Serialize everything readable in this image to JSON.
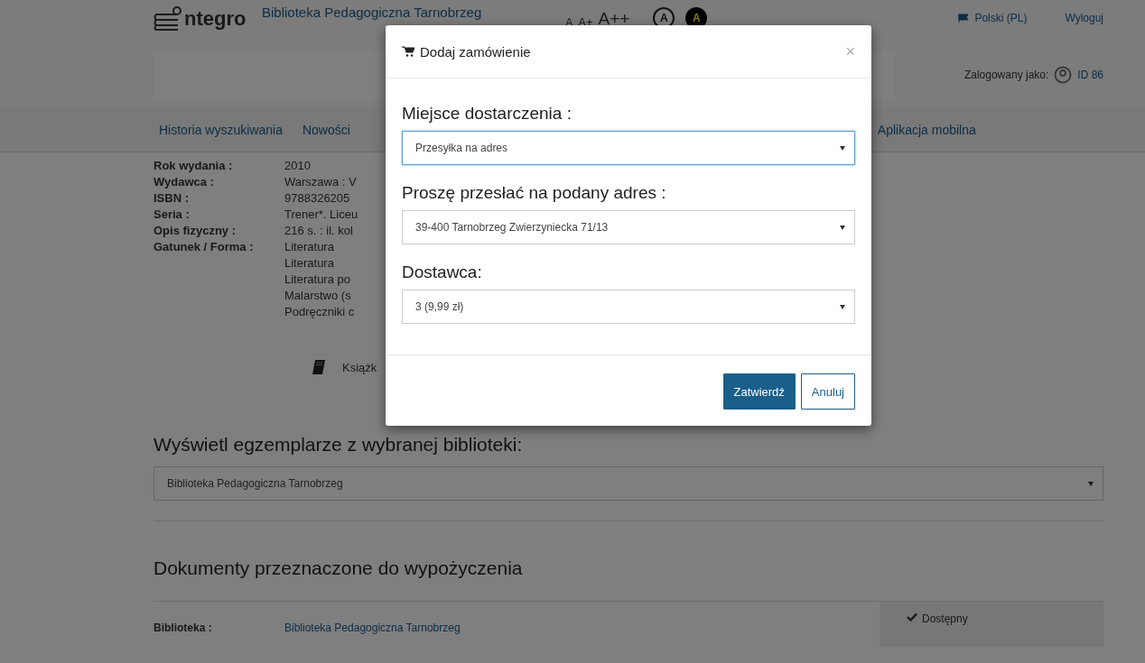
{
  "header": {
    "logo": "ntegro",
    "library_name": "Biblioteka Pedagogiczna Tarnobrzeg",
    "font_sizes": [
      "A",
      "A+",
      "A++"
    ],
    "contrast": [
      {
        "label": "A",
        "kind": "normal"
      },
      {
        "label": "A",
        "kind": "high"
      }
    ],
    "language": "Polski (PL)",
    "logout": "Wyloguj",
    "logged_in_label": "Zalogowany jako:",
    "user": "ID 86"
  },
  "nav": [
    {
      "label": "Historia wyszukiwania"
    },
    {
      "label": "Nowości"
    },
    {
      "label": "Aplikacja mobilna"
    }
  ],
  "details": [
    {
      "label": "Rok wydania :",
      "values": [
        "2010"
      ]
    },
    {
      "label": "Wydawca :",
      "values": [
        "Warszawa : V"
      ]
    },
    {
      "label": "ISBN :",
      "values": [
        "9788326205"
      ]
    },
    {
      "label": "Seria :",
      "values": [
        "Trener*. Liceu"
      ]
    },
    {
      "label": "Opis fizyczny :",
      "values": [
        "216 s. : il. kol"
      ]
    },
    {
      "label": "Gatunek / Forma :",
      "values": [
        "Literatura",
        "Literatura",
        "Literatura po",
        "Malarstwo (s",
        "Podręczniki c"
      ]
    }
  ],
  "format": "Książk",
  "library_select": {
    "heading": "Wyświetl egzemplarze z wybranej biblioteki:",
    "value": "Biblioteka Pedagogiczna Tarnobrzeg"
  },
  "documents": {
    "heading": "Dokumenty przeznaczone do wypożyczenia",
    "rows": [
      {
        "label": "Biblioteka :",
        "value": "Biblioteka Pedagogiczna Tarnobrzeg",
        "status": "Dostępny",
        "available": true
      }
    ]
  },
  "modal": {
    "title": "Dodaj zamówienie",
    "close": "×",
    "fields": [
      {
        "label": "Miejsce dostarczenia :",
        "value": "Przesyłka na adres",
        "focused": true
      },
      {
        "label": "Proszę przesłać na podany adres :",
        "value": "39-400 Tarnobrzeg Zwierzyniecka 71/13",
        "focused": false
      },
      {
        "label": "Dostawca:",
        "value": "3 (9,99 zł)",
        "focused": false
      }
    ],
    "buttons": [
      {
        "label": "Zatwierdź",
        "kind": "primary"
      },
      {
        "label": "Anuluj",
        "kind": "default"
      }
    ]
  }
}
